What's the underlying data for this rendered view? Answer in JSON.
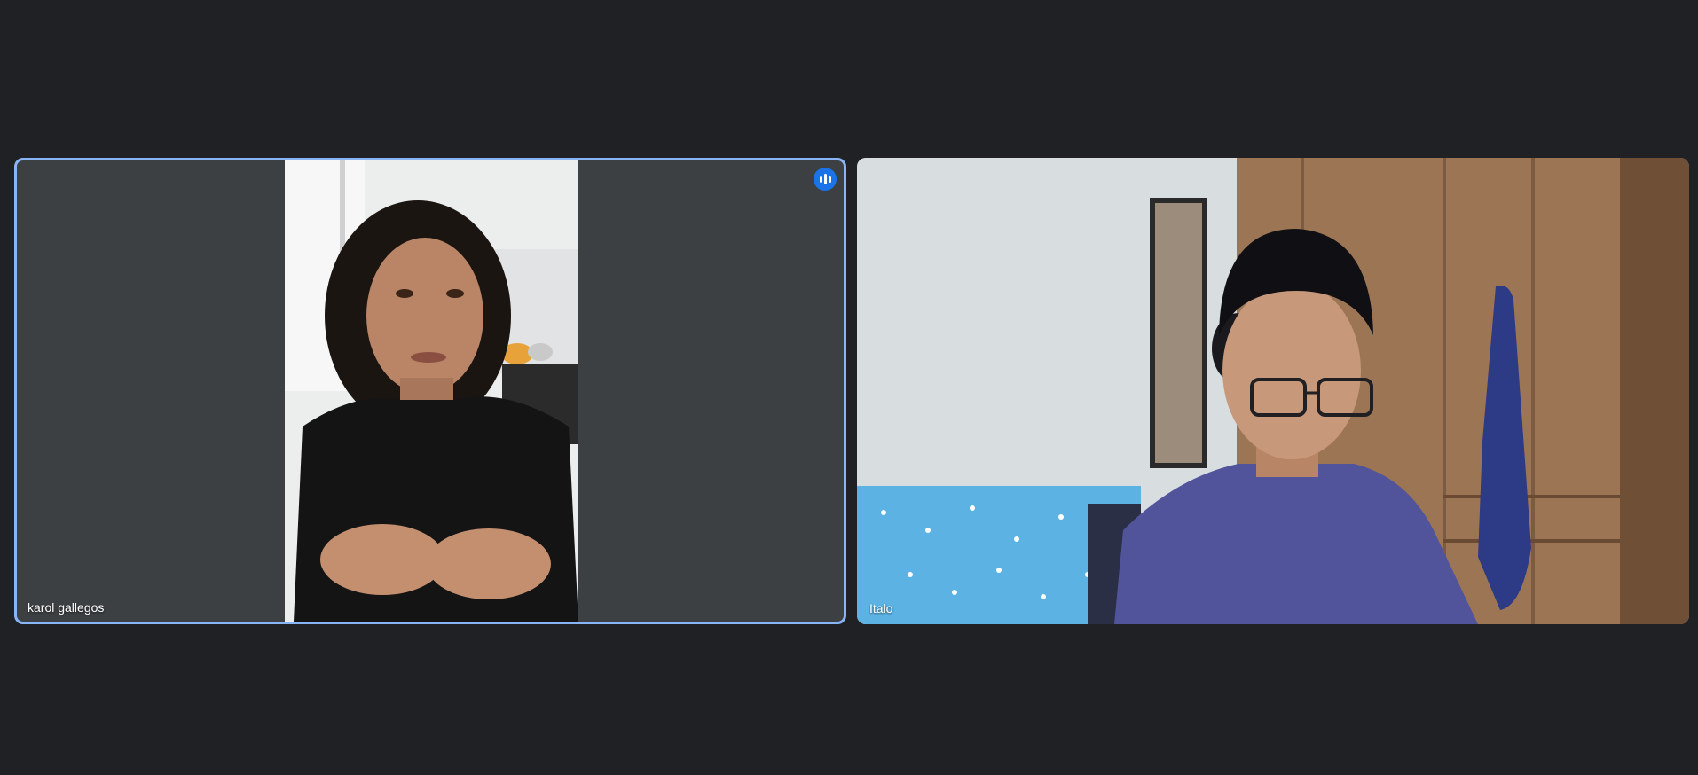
{
  "meeting": {
    "participants": [
      {
        "name": "karol gallegos",
        "is_speaking": true,
        "tile_accent": "#8ab4f8"
      },
      {
        "name": "Italo",
        "is_speaking": false
      }
    ]
  },
  "colors": {
    "background": "#202124",
    "tile_empty": "#3c4043",
    "speaking_indicator": "#1a73e8"
  },
  "icons": {
    "speaking": "audio-waveform-icon"
  }
}
